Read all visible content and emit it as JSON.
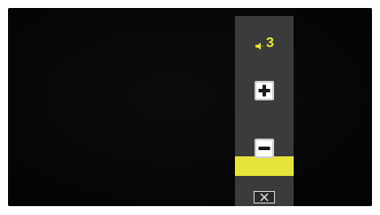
{
  "player": {
    "volume": {
      "value_label": "3",
      "level_fraction": 0.2,
      "accent_color": "#e6e43a",
      "icon": "speaker-icon"
    },
    "controls": {
      "increase_icon": "plus-icon",
      "decrease_icon": "minus-icon",
      "close_icon": "close-icon"
    }
  }
}
